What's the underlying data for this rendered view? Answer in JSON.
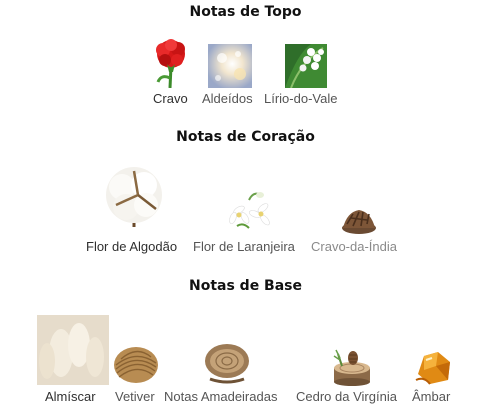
{
  "sections": [
    {
      "title": "Notas de Topo",
      "notes": [
        {
          "label": "Cravo",
          "icon": "red-carnation-icon"
        },
        {
          "label": "Aldeídos",
          "icon": "aldehydes-sparkle-icon"
        },
        {
          "label": "Lírio-do-Vale",
          "icon": "lily-of-the-valley-icon"
        }
      ]
    },
    {
      "title": "Notas de Coração",
      "notes": [
        {
          "label": "Flor de Algodão",
          "icon": "cotton-flower-icon"
        },
        {
          "label": "Flor de Laranjeira",
          "icon": "orange-blossom-icon"
        },
        {
          "label": "Cravo-da-Índia",
          "icon": "clove-icon"
        }
      ]
    },
    {
      "title": "Notas de Base",
      "notes": [
        {
          "label": "Almíscar",
          "icon": "musk-icon"
        },
        {
          "label": "Vetiver",
          "icon": "vetiver-icon"
        },
        {
          "label": "Notas Amadeiradas",
          "icon": "wood-log-icon"
        },
        {
          "label": "Cedro da Virgínia",
          "icon": "cedar-slice-icon"
        },
        {
          "label": "Âmbar",
          "icon": "amber-resin-icon"
        }
      ]
    }
  ]
}
